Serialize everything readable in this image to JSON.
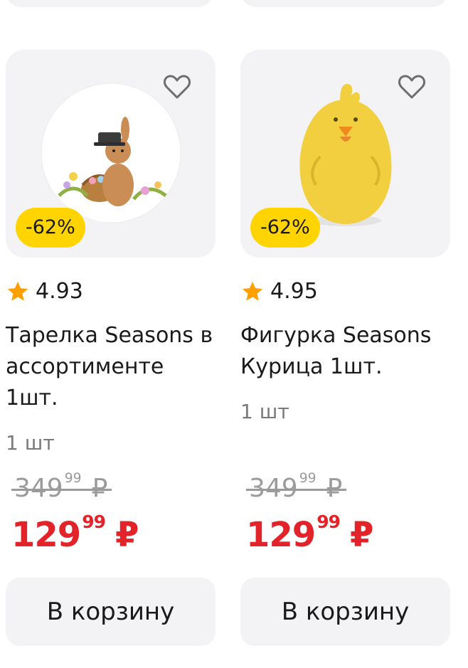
{
  "products": [
    {
      "image_desc_icon": "bunny-plate-image",
      "discount": "-62%",
      "rating": "4.93",
      "title": "Тарелка Seasons в ассортименте 1шт.",
      "quantity": "1 шт",
      "old_price_main": "349",
      "old_price_kop": "99",
      "new_price_main": "129",
      "new_price_kop": "99",
      "currency": "₽",
      "cart_label": "В корзину"
    },
    {
      "image_desc_icon": "chicken-figurine-image",
      "discount": "-62%",
      "rating": "4.95",
      "title": "Фигурка Seasons Курица 1шт.",
      "quantity": "1 шт",
      "old_price_main": "349",
      "old_price_kop": "99",
      "new_price_main": "129",
      "new_price_kop": "99",
      "currency": "₽",
      "cart_label": "В корзину"
    }
  ],
  "colors": {
    "badge": "#ffd400",
    "sale_price": "#e3232a",
    "card_bg": "#f3f3f5",
    "star": "#ffa000"
  }
}
